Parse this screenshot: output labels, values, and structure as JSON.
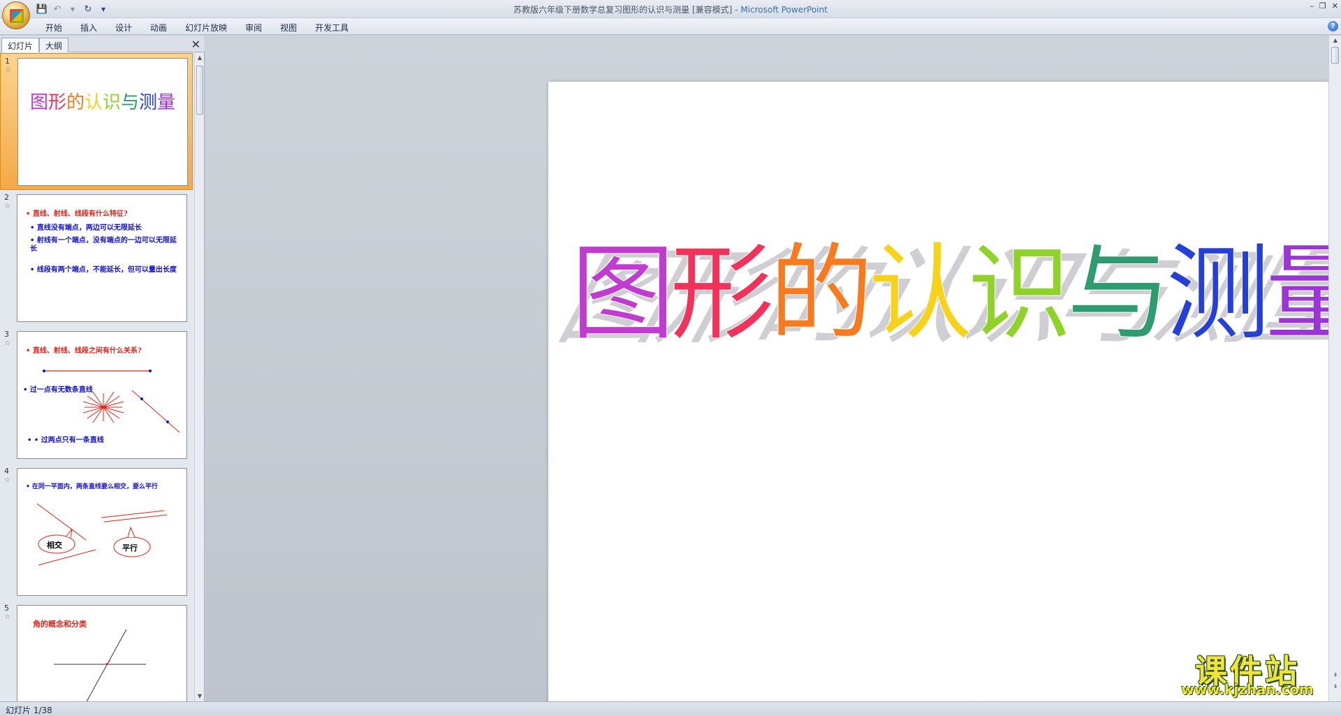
{
  "window": {
    "title": "苏教版六年级下册数学总复习图形的认识与测量 [兼容模式] - ",
    "app_name": "Microsoft PowerPoint",
    "minimize": "–",
    "restore": "❐",
    "close": "✕"
  },
  "ribbon": {
    "tabs": [
      "开始",
      "插入",
      "设计",
      "动画",
      "幻灯片放映",
      "审阅",
      "视图",
      "开发工具"
    ],
    "help": "?"
  },
  "pane": {
    "tab_slides": "幻灯片",
    "tab_outline": "大纲",
    "close": "✕"
  },
  "thumbnails": [
    {
      "num": "1",
      "title": "图形的认识与测量"
    },
    {
      "num": "2",
      "lines": [
        "直线、射线、线段有什么特征?",
        "直线没有端点，两边可以无限延长",
        "射线有一个端点，没有端点的一边可以无限延长",
        "线段有两个端点，不能延长，但可以量出长度"
      ]
    },
    {
      "num": "3",
      "lines": [
        "直线、射线、线段之间有什么关系?",
        "过一点有无数条直线",
        "过两点只有一条直线"
      ]
    },
    {
      "num": "4",
      "lines": [
        "在同一平面内，两条直线要么相交，要么平行",
        "相交",
        "平行"
      ]
    },
    {
      "num": "5",
      "lines": [
        "角的概念和分类"
      ]
    }
  ],
  "slide": {
    "title_chars": [
      "图",
      "形",
      "的",
      "认",
      "识",
      "与",
      "测",
      "量"
    ],
    "title_colors": [
      "#c23bd0",
      "#f2325a",
      "#f77a1e",
      "#f7d21a",
      "#8fd32a",
      "#2e9c6e",
      "#2540d8",
      "#9b35d8"
    ]
  },
  "status": {
    "slide_counter": "幻灯片 1/38"
  },
  "watermark": {
    "name": "课件站",
    "url": "www.kjzhan.com"
  }
}
